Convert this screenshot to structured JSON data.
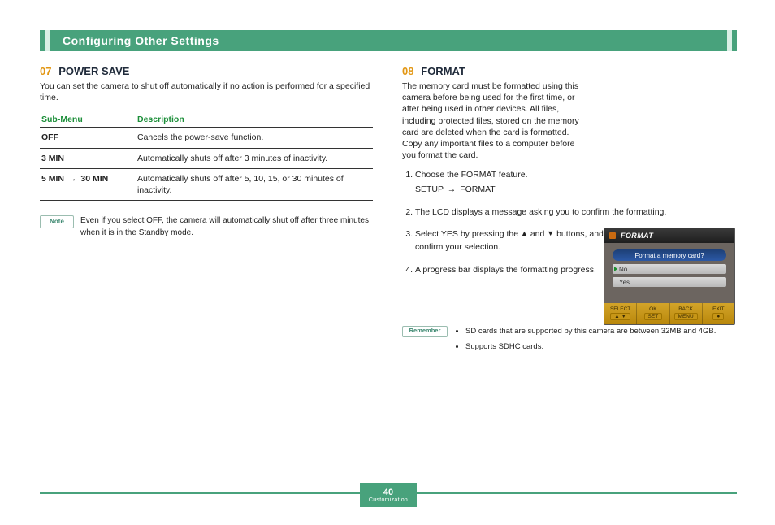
{
  "header": {
    "title": "Configuring Other Settings"
  },
  "footer": {
    "page": "40",
    "label": "Customization"
  },
  "left": {
    "sec_number": "07",
    "sec_title": "POWER SAVE",
    "intro": "You can set the camera to shut off automatically if no action is performed for a specified time.",
    "table_headers": {
      "submenu": "Sub-Menu",
      "desc": "Description"
    },
    "rows": [
      {
        "key": "OFF",
        "desc": "Cancels the power-save function."
      },
      {
        "key": "3 MIN",
        "desc": "Automatically shuts off after 3 minutes of inactivity."
      },
      {
        "key_a": "5 MIN",
        "arrow": "→",
        "key_b": "30 MIN",
        "desc": "Automatically shuts off after 5, 10, 15, or 30 minutes of inactivity."
      }
    ],
    "note_label": "Note",
    "note_body": "Even if you select OFF, the camera will automatically shut off after three minutes when it is in the Standby mode."
  },
  "right": {
    "sec_number": "08",
    "sec_title": "FORMAT",
    "intro": "The memory card must be formatted using this camera before being used for the first time, or after being used in other devices. All files, including protected files, stored on the memory card are deleted when the card is formatted. Copy any important files to a computer before you format the card.",
    "steps": [
      {
        "t": "Choose the FORMAT feature.",
        "sub_a": "SETUP ",
        "arrow": "→",
        "sub_b": " FORMAT"
      },
      {
        "t": "The LCD displays a message asking you to confirm the formatting."
      },
      {
        "t_pre": "Select YES by pressing the ",
        "tri_up": "▲",
        "t_mid": " and ",
        "tri_dn": "▼",
        "t_post": " buttons, and then press the SET button to confirm your selection."
      },
      {
        "t": "A progress bar displays the formatting progress."
      }
    ],
    "thumb": {
      "title": "FORMAT",
      "question": "Format a memory card?",
      "opt_no": "No",
      "opt_yes": "Yes",
      "foot": [
        {
          "k": "SELECT",
          "b": "▲ ▼"
        },
        {
          "k": "OK",
          "b": "SET"
        },
        {
          "k": "BACK",
          "b": "MENU"
        },
        {
          "k": "EXIT",
          "b": "●"
        }
      ]
    },
    "remember_label": "Remember",
    "remember_items": [
      "SD cards that are supported by this camera are between 32MB and 4GB.",
      "Supports SDHC cards."
    ]
  },
  "colors": {
    "accent": "#48a27c",
    "orange": "#e29612"
  }
}
